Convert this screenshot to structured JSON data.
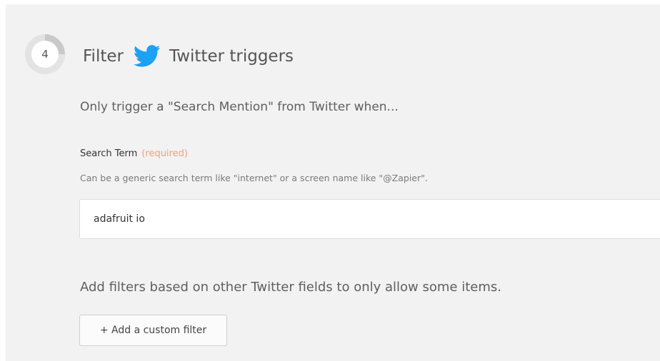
{
  "step": {
    "number": "4",
    "title_prefix": "Filter",
    "title_suffix": "Twitter triggers",
    "app_icon": "twitter-bird-icon",
    "progress": 0.25
  },
  "subtitle": "Only trigger a \"Search Mention\" from Twitter when...",
  "search_term": {
    "label": "Search Term",
    "required_tag": "(required)",
    "help": "Can be a generic search term like \"internet\" or a screen name like \"@Zapier\".",
    "value": "adafruit io"
  },
  "filters": {
    "description": "Add filters based on other Twitter fields to only allow some items.",
    "add_button_label": "+ Add a custom filter"
  },
  "colors": {
    "twitter_blue": "#1da1f2",
    "required_orange": "#f0a07a",
    "panel_background": "#f2f2f2"
  }
}
